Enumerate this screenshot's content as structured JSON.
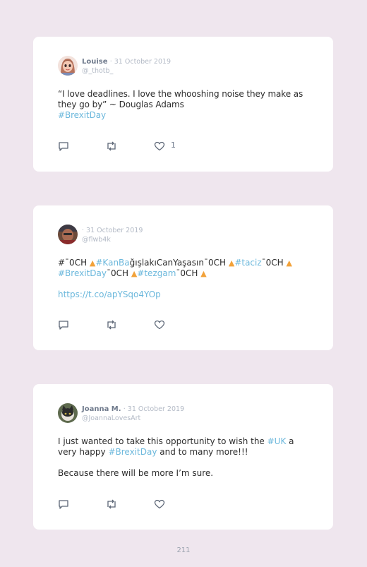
{
  "tweets": [
    {
      "name": "Louise",
      "date": "· 31 October 2019",
      "handle": "@_thotb_",
      "text_1": "“I love deadlines. I love the whooshing noise they make as they go by” ~ Douglas Adams",
      "hashtag_1": "#BrexitDay",
      "like_count": "1"
    },
    {
      "name": "",
      "date": "· 31 October 2019",
      "handle": "@flwb4k",
      "seg_1": "#ˉ0CH ",
      "seg_2": "#KanBa",
      "seg_3": "ğışlakıCanYaşasınˉ0CH ",
      "seg_4": "#taciz",
      "seg_5": "ˉ0CH ",
      "seg_6": "#BrexitDay",
      "seg_7": "ˉ0CH ",
      "seg_8": "#tezgam",
      "seg_9": "ˉ0CH ",
      "link": "https://t.co/apYSqo4YOp"
    },
    {
      "name": "Joanna M.",
      "date": "· 31 October 2019",
      "handle": "@JoannaLovesArt",
      "text_1": "I just wanted to take this opportunity to wish the ",
      "hashtag_1": "#UK",
      "text_2": " a very happy ",
      "hashtag_2": "#BrexitDay",
      "text_3": " and to many more!!!",
      "text_4": "Because there will be more I’m sure."
    }
  ],
  "icons": {
    "reply": "reply-icon",
    "retweet": "retweet-icon",
    "like": "heart-icon",
    "emoji": "fire-emoji-icon"
  },
  "page_number": "211"
}
